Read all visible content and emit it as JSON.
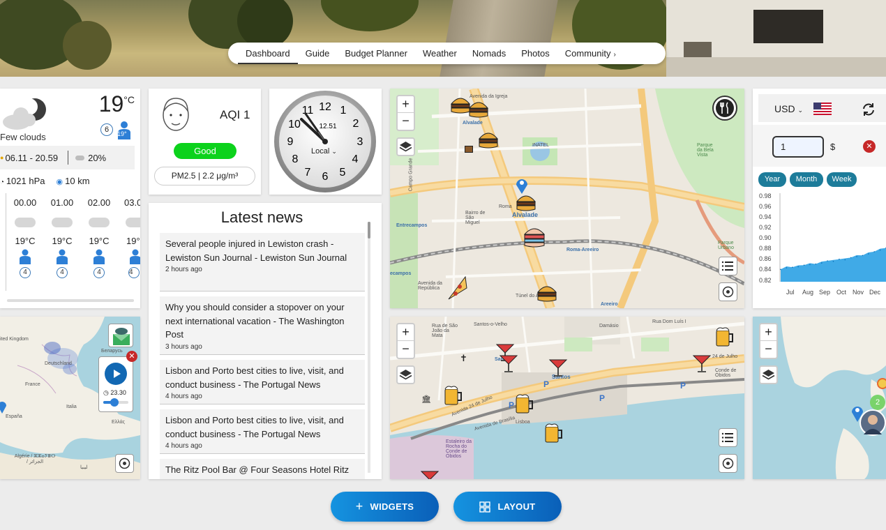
{
  "nav": {
    "items": [
      "Dashboard",
      "Guide",
      "Budget Planner",
      "Weather",
      "Nomads",
      "Photos",
      "Community"
    ],
    "active": "Dashboard"
  },
  "weather": {
    "temp": "19",
    "unit": "°C",
    "desc": "Few clouds",
    "uv_badge": "6",
    "feels_badge": "19°",
    "range": "06.11 - 20.59",
    "clouds": "20%",
    "pressure": "1021 hPa",
    "visibility": "10 km",
    "hours": [
      {
        "time": "00.00",
        "temp": "19°C",
        "feels": "19°",
        "uv": "4"
      },
      {
        "time": "01.00",
        "temp": "19°C",
        "feels": "19°",
        "uv": "4"
      },
      {
        "time": "02.00",
        "temp": "19°C",
        "feels": "19°",
        "uv": "4"
      },
      {
        "time": "03.0",
        "temp": "19°",
        "feels": "19°",
        "uv": "4"
      }
    ]
  },
  "aqi": {
    "label": "AQI 1",
    "status": "Good",
    "pm": "PM2.5 | 2.2 μg/m³",
    "status_color": "#0cd21c"
  },
  "clock": {
    "numbers": [
      "12",
      "1",
      "2",
      "3",
      "4",
      "5",
      "6",
      "7",
      "8",
      "9",
      "10",
      "11"
    ],
    "digital": "12.51",
    "zone": "Local"
  },
  "news": {
    "title": "Latest news",
    "items": [
      {
        "headline": "Several people injured in Lewiston crash - Lewiston Sun Journal - Lewiston Sun Journal",
        "time": "2 hours ago"
      },
      {
        "headline": "Why you should consider a stopover on your next international vacation - The Washington Post",
        "time": "3 hours ago"
      },
      {
        "headline": "Lisbon and Porto best cities to live, visit, and conduct business - The Portugal News",
        "time": "4 hours ago"
      },
      {
        "headline": "Lisbon and Porto best cities to live, visit, and conduct business - The Portugal News",
        "time": "4 hours ago"
      },
      {
        "headline": "The Ritz Pool Bar @ Four Seasons Hotel Ritz",
        "time": ""
      }
    ]
  },
  "radar_map": {
    "labels": [
      "ited Kingdom",
      "Deutschland",
      "France",
      "Italia",
      "España",
      "Беларусь",
      "Ελλάς",
      "Algérie / ⵣⵣⴰⵢⴻⵔ / الجزائر",
      "ليبيا"
    ],
    "play_time": "23.30"
  },
  "food_map": {
    "labels": [
      "Avenida da Igreja",
      "Alvalade",
      "INATEL",
      "Parque da Bela Vista",
      "Campo Grande",
      "Roma",
      "Alvalade",
      "Bairro de São Miguel",
      "Entrecampos",
      "Roma-Areeiro",
      "Parque Urbano",
      "Avenida da República",
      "Túnel do Areeiro",
      "Areeiro",
      "ecampos"
    ]
  },
  "bar_map": {
    "labels": [
      "Santos-o-Velho",
      "Rua de São João da Mata",
      "Santos",
      "Santos",
      "Avenida 24 de Julho",
      "Rua Dom Luís I",
      "24 de Julho",
      "Conde de Óbidos",
      "Estaleiro da Rocha do Conde de Óbidos",
      "Lisboa",
      "Avenida de Brasília",
      "Damásio"
    ]
  },
  "currency": {
    "code": "USD",
    "amount": "1",
    "symbol": "$",
    "ranges": [
      "Year",
      "Month",
      "Week"
    ],
    "accent": "#1d7c9a"
  },
  "chart_data": {
    "type": "area",
    "categories": [
      "Jul",
      "Aug",
      "Sep",
      "Oct",
      "Nov",
      "Dec"
    ],
    "ylim": [
      0.82,
      0.98
    ],
    "yticks": [
      "0.98",
      "0.96",
      "0.94",
      "0.92",
      "0.90",
      "0.88",
      "0.86",
      "0.84",
      "0.82"
    ],
    "series": [
      {
        "values": [
          0.843,
          0.846,
          0.847,
          0.848,
          0.851,
          0.852,
          0.853,
          0.855,
          0.859,
          0.858,
          0.862,
          0.861,
          0.865,
          0.867,
          0.869,
          0.872,
          0.876,
          0.879,
          0.883
        ]
      }
    ],
    "color": "#1e9be3"
  },
  "world_map": {
    "cluster_count": "2"
  },
  "buttons": {
    "widgets": "WIDGETS",
    "layout": "LAYOUT"
  }
}
